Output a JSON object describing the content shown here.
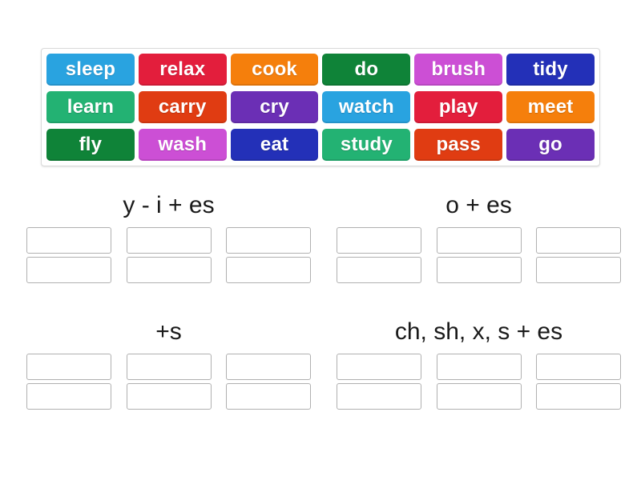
{
  "word_bank": {
    "name": "word-bank",
    "rows": [
      [
        {
          "label": "sleep",
          "color": "#29a3e0"
        },
        {
          "label": "relax",
          "color": "#e31e3c"
        },
        {
          "label": "cook",
          "color": "#f57f0c"
        },
        {
          "label": "do",
          "color": "#0f8338"
        },
        {
          "label": "brush",
          "color": "#cc4fd5"
        },
        {
          "label": "tidy",
          "color": "#2330b8"
        }
      ],
      [
        {
          "label": "learn",
          "color": "#23b273"
        },
        {
          "label": "carry",
          "color": "#e03c12"
        },
        {
          "label": "cry",
          "color": "#6b2fb5"
        },
        {
          "label": "watch",
          "color": "#29a3e0"
        },
        {
          "label": "play",
          "color": "#e31e3c"
        },
        {
          "label": "meet",
          "color": "#f57f0c"
        }
      ],
      [
        {
          "label": "fly",
          "color": "#0f8338"
        },
        {
          "label": "wash",
          "color": "#cc4fd5"
        },
        {
          "label": "eat",
          "color": "#2330b8"
        },
        {
          "label": "study",
          "color": "#23b273"
        },
        {
          "label": "pass",
          "color": "#e03c12"
        },
        {
          "label": "go",
          "color": "#6b2fb5"
        }
      ]
    ]
  },
  "groups": [
    {
      "title": "y - i + es",
      "slots": [
        "",
        "",
        "",
        "",
        "",
        ""
      ]
    },
    {
      "title": "o + es",
      "slots": [
        "",
        "",
        "",
        "",
        "",
        ""
      ]
    },
    {
      "title": "+s",
      "slots": [
        "",
        "",
        "",
        "",
        "",
        ""
      ]
    },
    {
      "title": "ch, sh, x, s + es",
      "slots": [
        "",
        "",
        "",
        "",
        "",
        ""
      ]
    }
  ]
}
